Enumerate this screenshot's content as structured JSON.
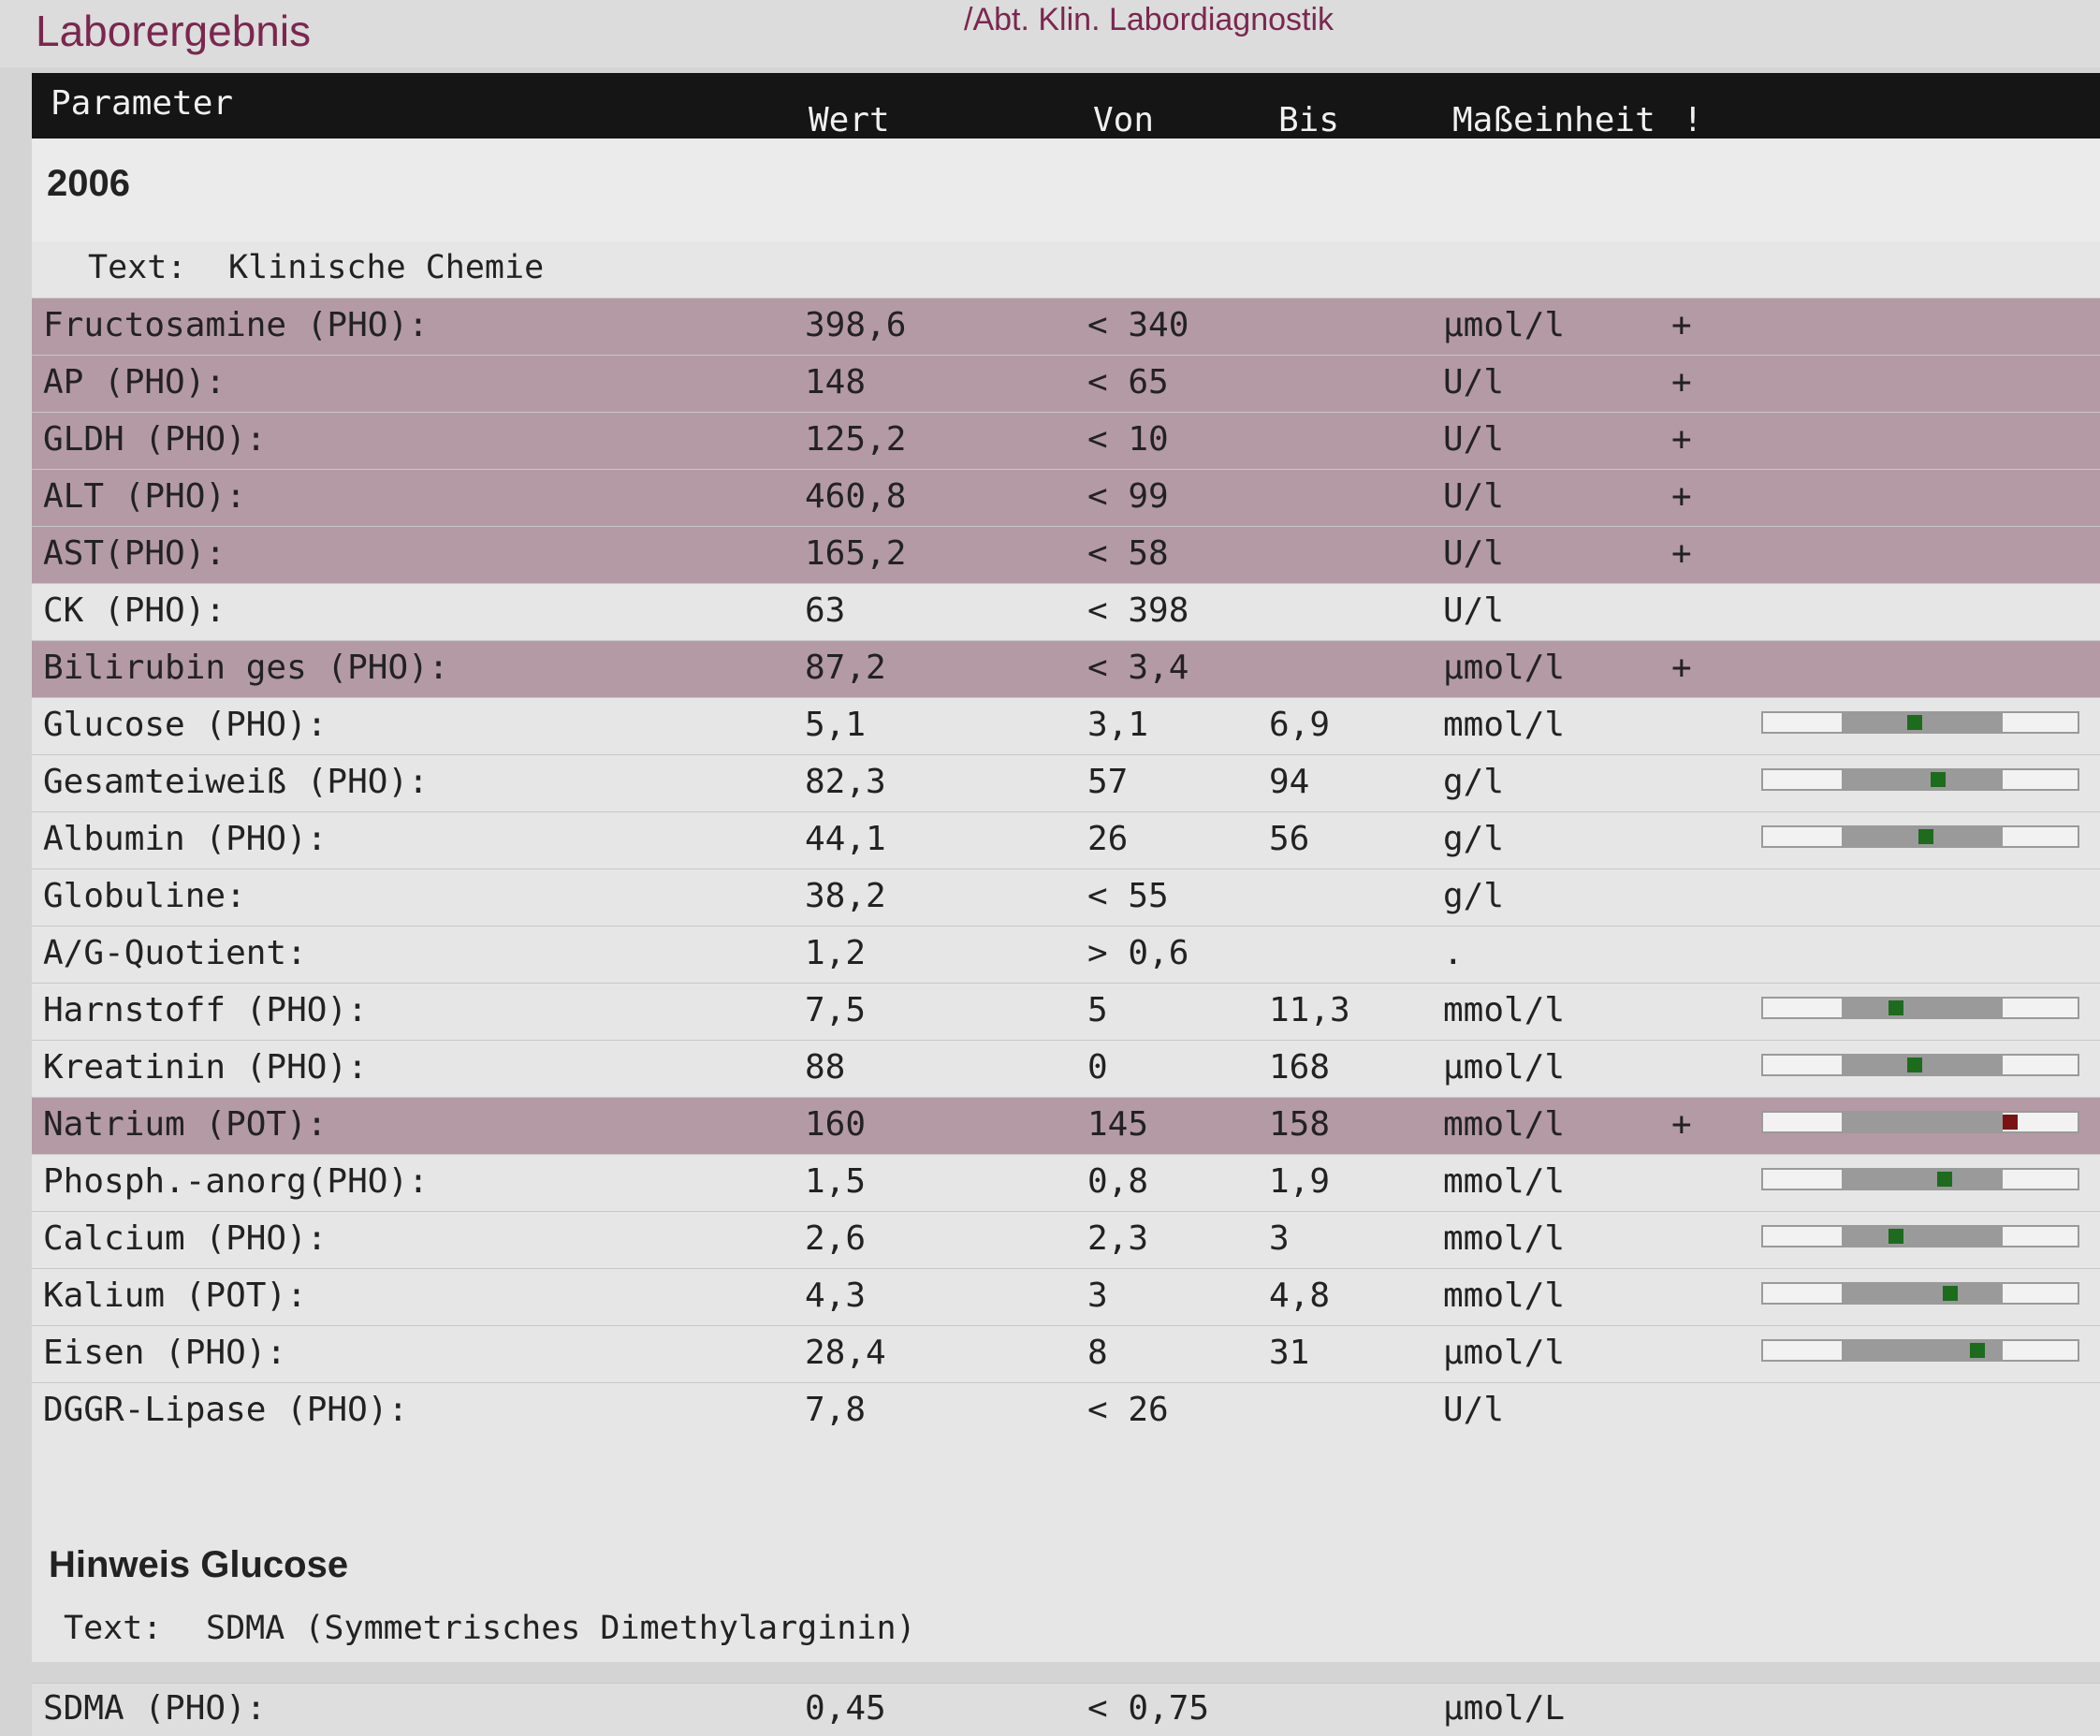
{
  "window": {
    "title": "Laborergebnis",
    "department": "/Abt. Klin. Labordiagnostik"
  },
  "header": {
    "parameter": "Parameter",
    "wert": "Wert",
    "von": "Von",
    "bis": "Bis",
    "unit": "Maßeinheit",
    "flag": "!"
  },
  "year": "2006",
  "section": {
    "label": "Text:",
    "value": "Klinische Chemie"
  },
  "rows": [
    {
      "name": "Fructosamine (PHO):",
      "wert": "398,6",
      "von": "< 340",
      "bis": "",
      "unit": "µmol/l",
      "flag": "+",
      "flagged": true,
      "gauge": null
    },
    {
      "name": "AP (PHO):",
      "wert": "148",
      "von": "< 65",
      "bis": "",
      "unit": "U/l",
      "flag": "+",
      "flagged": true,
      "gauge": null
    },
    {
      "name": "GLDH (PHO):",
      "wert": "125,2",
      "von": "< 10",
      "bis": "",
      "unit": "U/l",
      "flag": "+",
      "flagged": true,
      "gauge": null
    },
    {
      "name": "ALT (PHO):",
      "wert": "460,8",
      "von": "< 99",
      "bis": "",
      "unit": "U/l",
      "flag": "+",
      "flagged": true,
      "gauge": null
    },
    {
      "name": "AST(PHO):",
      "wert": "165,2",
      "von": "< 58",
      "bis": "",
      "unit": "U/l",
      "flag": "+",
      "flagged": true,
      "gauge": null
    },
    {
      "name": "CK (PHO):",
      "wert": "63",
      "von": "< 398",
      "bis": "",
      "unit": "U/l",
      "flag": "",
      "flagged": false,
      "gauge": null
    },
    {
      "name": "Bilirubin ges (PHO):",
      "wert": "87,2",
      "von": "< 3,4",
      "bis": "",
      "unit": "µmol/l",
      "flag": "+",
      "flagged": true,
      "gauge": null
    },
    {
      "name": "Glucose (PHO):",
      "wert": "5,1",
      "von": "3,1",
      "bis": "6,9",
      "unit": "mmol/l",
      "flag": "",
      "flagged": false,
      "gauge": 0.48
    },
    {
      "name": "Gesamteiweiß (PHO):",
      "wert": "82,3",
      "von": "57",
      "bis": "94",
      "unit": "g/l",
      "flag": "",
      "flagged": false,
      "gauge": 0.56
    },
    {
      "name": "Albumin (PHO):",
      "wert": "44,1",
      "von": "26",
      "bis": "56",
      "unit": "g/l",
      "flag": "",
      "flagged": false,
      "gauge": 0.52
    },
    {
      "name": "Globuline:",
      "wert": "38,2",
      "von": "< 55",
      "bis": "",
      "unit": "g/l",
      "flag": "",
      "flagged": false,
      "gauge": null
    },
    {
      "name": "A/G-Quotient:",
      "wert": "1,2",
      "von": "> 0,6",
      "bis": "",
      "unit": ".",
      "flag": "",
      "flagged": false,
      "gauge": null
    },
    {
      "name": "Harnstoff (PHO):",
      "wert": "7,5",
      "von": "5",
      "bis": "11,3",
      "unit": "mmol/l",
      "flag": "",
      "flagged": false,
      "gauge": 0.42
    },
    {
      "name": "Kreatinin (PHO):",
      "wert": "88",
      "von": "0",
      "bis": "168",
      "unit": "µmol/l",
      "flag": "",
      "flagged": false,
      "gauge": 0.48
    },
    {
      "name": "Natrium (POT):",
      "wert": "160",
      "von": "145",
      "bis": "158",
      "unit": "mmol/l",
      "flag": "+",
      "flagged": true,
      "gauge": 0.8
    },
    {
      "name": "Phosph.-anorg(PHO):",
      "wert": "1,5",
      "von": "0,8",
      "bis": "1,9",
      "unit": "mmol/l",
      "flag": "",
      "flagged": false,
      "gauge": 0.58
    },
    {
      "name": "Calcium (PHO):",
      "wert": "2,6",
      "von": "2,3",
      "bis": "3",
      "unit": "mmol/l",
      "flag": "",
      "flagged": false,
      "gauge": 0.42
    },
    {
      "name": "Kalium (POT):",
      "wert": "4,3",
      "von": "3",
      "bis": "4,8",
      "unit": "mmol/l",
      "flag": "",
      "flagged": false,
      "gauge": 0.6
    },
    {
      "name": "Eisen (PHO):",
      "wert": "28,4",
      "von": "8",
      "bis": "31",
      "unit": "µmol/l",
      "flag": "",
      "flagged": false,
      "gauge": 0.69
    },
    {
      "name": "DGGR-Lipase (PHO):",
      "wert": "7,8",
      "von": "< 26",
      "bis": "",
      "unit": "U/l",
      "flag": "",
      "flagged": false,
      "gauge": null
    }
  ],
  "hinweis": "Hinweis Glucose",
  "sdma_text": {
    "label": "Text:",
    "value": "SDMA (Symmetrisches Dimethylarginin)"
  },
  "sdma": {
    "name": "SDMA (PHO):",
    "wert": "0,45",
    "von": "< 0,75",
    "unit": "µmol/L"
  }
}
